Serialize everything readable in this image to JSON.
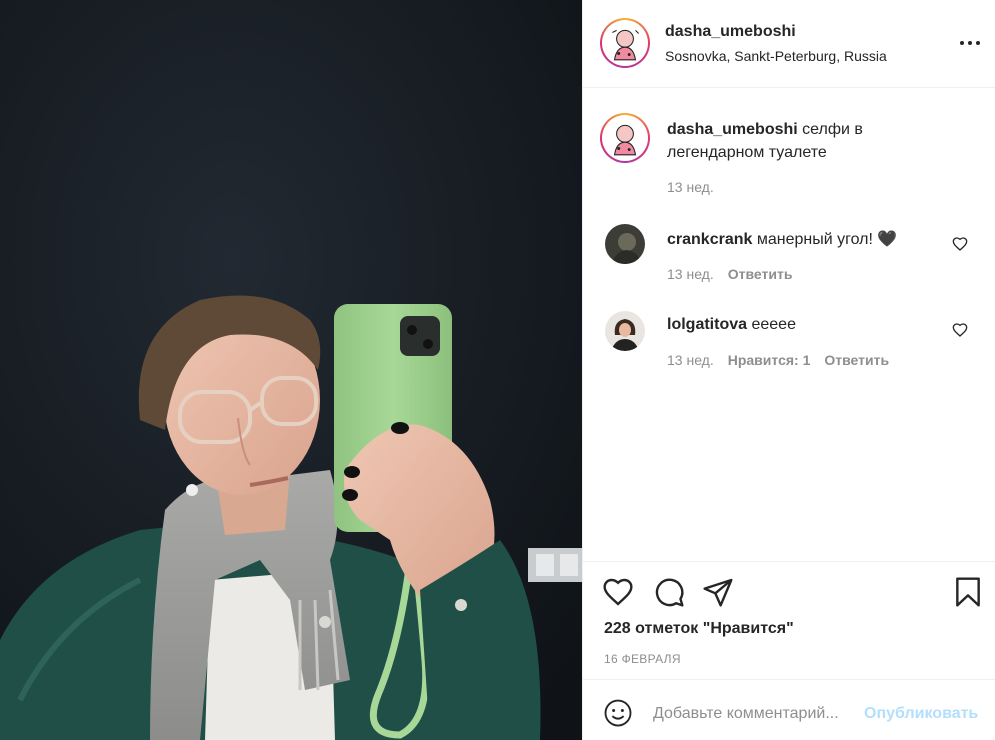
{
  "post": {
    "username": "dasha_umeboshi",
    "location": "Sosnovka, Sankt-Peterburg, Russia",
    "more_icon": "more-horizontal-icon",
    "caption": {
      "username": "dasha_umeboshi",
      "text": "селфи в легендарном туалете",
      "time": "13 нед."
    },
    "comments": [
      {
        "username": "crankcrank",
        "text": "манерный угол! 🖤",
        "time": "13 нед.",
        "likes_label": "",
        "reply_label": "Ответить"
      },
      {
        "username": "lolgatitova",
        "text": "eeeee",
        "time": "13 нед.",
        "likes_label": "Нравится: 1",
        "reply_label": "Ответить"
      }
    ],
    "actions": {
      "like_icon": "heart-icon",
      "comment_icon": "comment-icon",
      "share_icon": "paper-plane-icon",
      "save_icon": "bookmark-icon"
    },
    "likes_text": "228 отметок \"Нравится\"",
    "date": "16 ФЕВРАЛЯ",
    "add_comment": {
      "placeholder": "Добавьте комментарий...",
      "publish_label": "Опубликовать",
      "emoji_icon": "smiley-icon"
    }
  },
  "colors": {
    "text": "#262626",
    "secondary": "#8e8e8e",
    "border": "#efefef",
    "publish_disabled": "#b2dffc",
    "phone_case": "#9fd08f",
    "jacket": "#1f4f47",
    "wall": "#161b20"
  }
}
